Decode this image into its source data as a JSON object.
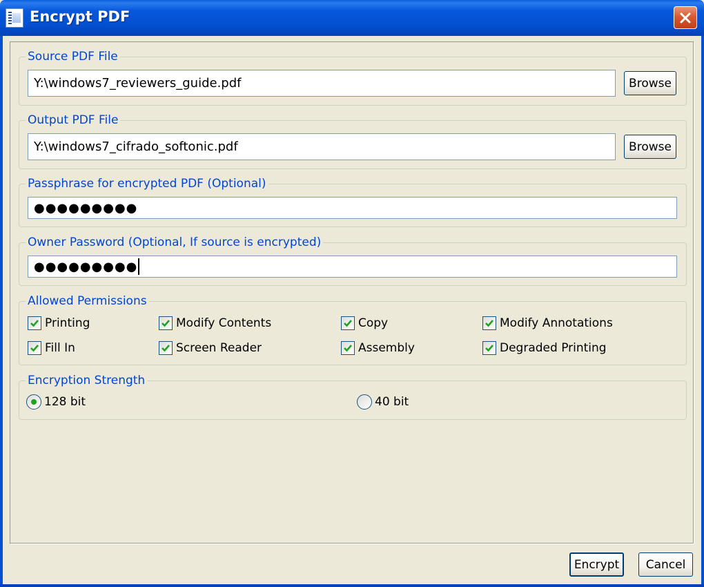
{
  "window": {
    "title": "Encrypt PDF"
  },
  "source": {
    "legend": "Source PDF File",
    "value": "Y:\\windows7_reviewers_guide.pdf",
    "browse_label": "Browse"
  },
  "output": {
    "legend": "Output PDF File",
    "value": "Y:\\windows7_cifrado_softonic.pdf",
    "browse_label": "Browse"
  },
  "passphrase": {
    "legend": "Passphrase for encrypted PDF (Optional)",
    "masked_value": "●●●●●●●●●"
  },
  "owner": {
    "legend": "Owner Password (Optional, If source is encrypted)",
    "masked_value": "●●●●●●●●●"
  },
  "permissions": {
    "legend": "Allowed Permissions",
    "items": [
      {
        "label": "Printing",
        "checked": true
      },
      {
        "label": "Modify Contents",
        "checked": true
      },
      {
        "label": "Copy",
        "checked": true
      },
      {
        "label": "Modify Annotations",
        "checked": true
      },
      {
        "label": "Fill In",
        "checked": true
      },
      {
        "label": "Screen Reader",
        "checked": true
      },
      {
        "label": "Assembly",
        "checked": true
      },
      {
        "label": "Degraded Printing",
        "checked": true
      }
    ]
  },
  "strength": {
    "legend": "Encryption Strength",
    "options": [
      {
        "label": "128 bit",
        "selected": true
      },
      {
        "label": "40 bit",
        "selected": false
      }
    ]
  },
  "actions": {
    "encrypt_label": "Encrypt",
    "cancel_label": "Cancel"
  },
  "colors": {
    "titlebar": "#0450D0",
    "legend": "#0046D5",
    "check": "#21A121",
    "face": "#ECE9D8"
  }
}
